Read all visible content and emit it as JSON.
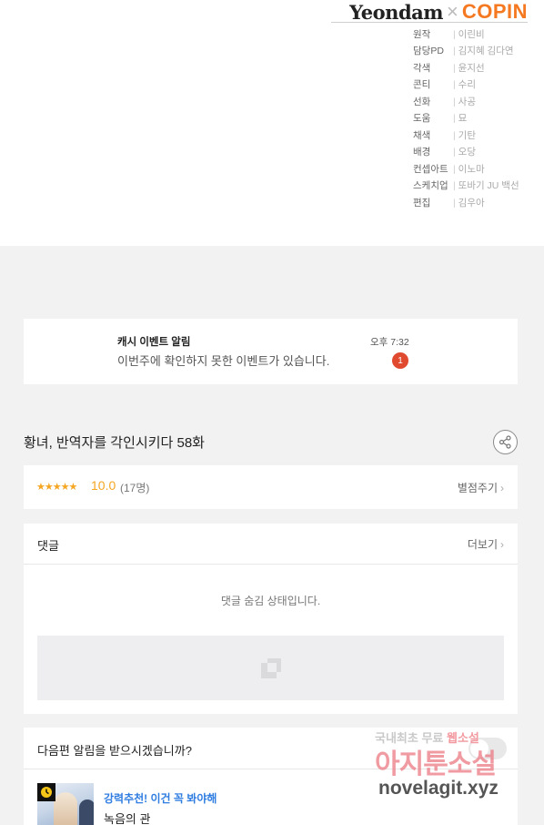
{
  "logo": {
    "left": "Yeondam",
    "separator": "×",
    "right": "COPIN"
  },
  "credits": [
    {
      "role": "원작",
      "name": "이린비"
    },
    {
      "role": "담당PD",
      "name": "김지혜 김다연"
    },
    {
      "role": "각색",
      "name": "윤지선"
    },
    {
      "role": "콘티",
      "name": "수리"
    },
    {
      "role": "선화",
      "name": "사공"
    },
    {
      "role": "도움",
      "name": "묘"
    },
    {
      "role": "채색",
      "name": "기탄"
    },
    {
      "role": "배경",
      "name": "오당"
    },
    {
      "role": "컨셉아트",
      "name": "이노마"
    },
    {
      "role": "스케치업",
      "name": "또바기 JU 백선"
    },
    {
      "role": "편집",
      "name": "김우아"
    }
  ],
  "notice": {
    "title": "캐시 이벤트 알림",
    "body": "이번주에 확인하지 못한 이벤트가 있습니다.",
    "time": "오후 7:32",
    "badge": "1"
  },
  "episode": {
    "title": "황녀, 반역자를 각인시키다 58화"
  },
  "rating": {
    "stars": "★★★★★",
    "score": "10.0",
    "count": "(17명)",
    "rate_link": "별점주기",
    "star_color": "#f5a623"
  },
  "comments": {
    "title": "댓글",
    "more": "더보기",
    "hidden_text": "댓글 숨김 상태입니다."
  },
  "next_episode": {
    "title": "다음편 알림을 받으시겠습니까?",
    "toggle_on": false
  },
  "recommendation": {
    "label": "강력추천! 이건 꼭 봐야해",
    "title": "녹음의 관",
    "label_color": "#2f7de1"
  },
  "watermark": {
    "line1_a": "국내최초 무료",
    "line1_b": "웹소설",
    "line2": "아지툰소설",
    "line3": "novelagit.xyz"
  },
  "icons": {
    "share": "share-icon",
    "chevron": "chevron-right-icon",
    "clock": "clock-icon",
    "ad": "ad-placeholder-icon"
  }
}
